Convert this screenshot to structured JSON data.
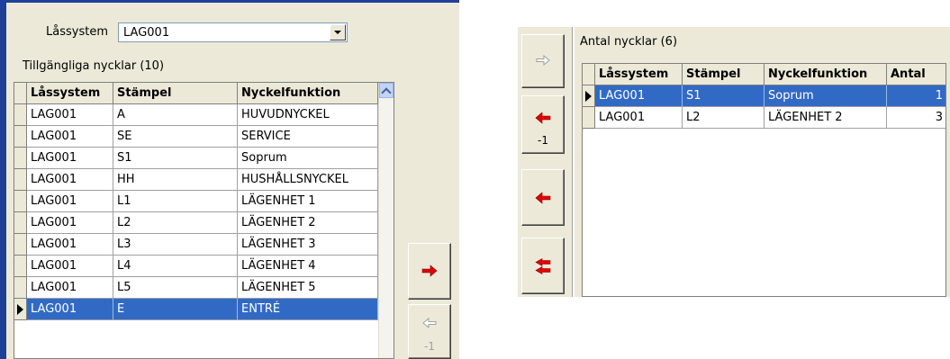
{
  "left": {
    "lock_system_label": "Låssystem",
    "lock_system_value": "LAG001",
    "available_keys_label": "Tillgängliga nycklar (10)",
    "columns": [
      "Låssystem",
      "Stämpel",
      "Nyckelfunktion"
    ],
    "rows": [
      {
        "system": "LAG001",
        "stamp": "A",
        "function": "HUVUDNYCKEL"
      },
      {
        "system": "LAG001",
        "stamp": "SE",
        "function": "SERVICE"
      },
      {
        "system": "LAG001",
        "stamp": "S1",
        "function": "Soprum"
      },
      {
        "system": "LAG001",
        "stamp": "HH",
        "function": "HUSHÅLLSNYCKEL"
      },
      {
        "system": "LAG001",
        "stamp": "L1",
        "function": "LÄGENHET 1"
      },
      {
        "system": "LAG001",
        "stamp": "L2",
        "function": "LÄGENHET 2"
      },
      {
        "system": "LAG001",
        "stamp": "L3",
        "function": "LÄGENHET 3"
      },
      {
        "system": "LAG001",
        "stamp": "L4",
        "function": "LÄGENHET 4"
      },
      {
        "system": "LAG001",
        "stamp": "L5",
        "function": "LÄGENHET 5"
      },
      {
        "system": "LAG001",
        "stamp": "E",
        "function": "ENTRÉ"
      }
    ],
    "selected_row": 9,
    "add_button_icon": "arrow-right-red-icon",
    "remove_one_button": {
      "icon": "arrow-left-outline-icon",
      "label": "-1"
    }
  },
  "right": {
    "key_count_label": "Antal nycklar (6)",
    "columns": [
      "Låssystem",
      "Stämpel",
      "Nyckelfunktion",
      "Antal"
    ],
    "rows": [
      {
        "system": "LAG001",
        "stamp": "S1",
        "function": "Soprum",
        "count": "1"
      },
      {
        "system": "LAG001",
        "stamp": "L2",
        "function": "LÄGENHET 2",
        "count": "3"
      }
    ],
    "selected_row": 0,
    "buttons": [
      {
        "icon": "arrow-right-outline-icon",
        "label": ""
      },
      {
        "icon": "arrow-left-red-icon",
        "label": "-1"
      },
      {
        "icon": "arrow-left-red-icon",
        "label": ""
      },
      {
        "icon": "double-arrow-left-red-icon",
        "label": ""
      }
    ]
  },
  "colors": {
    "selection": "#316ac5",
    "panel": "#ece9d8",
    "arrow_red": "#e00000"
  }
}
